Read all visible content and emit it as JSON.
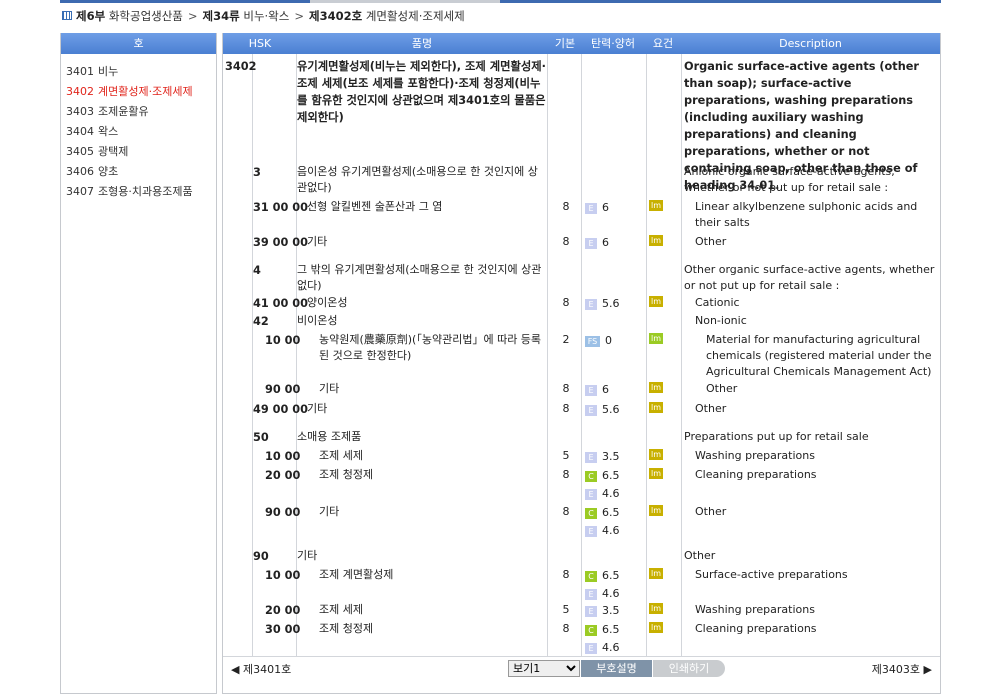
{
  "breadcrumb": {
    "part": "제6부",
    "part_label": "화학공업생산품",
    "chapter": "제34류",
    "chapter_label": "비누·왁스",
    "heading": "제3402호",
    "heading_label": "계면활성제·조제세제"
  },
  "sidebar": {
    "header": "호",
    "items": [
      {
        "code": "3401",
        "label": "비누"
      },
      {
        "code": "3402",
        "label": "계면활성제·조제세제",
        "active": true
      },
      {
        "code": "3403",
        "label": "조제윤활유"
      },
      {
        "code": "3404",
        "label": "왁스"
      },
      {
        "code": "3405",
        "label": "광택제"
      },
      {
        "code": "3406",
        "label": "양초"
      },
      {
        "code": "3407",
        "label": "조형용·치과용조제품"
      }
    ]
  },
  "table": {
    "headers": {
      "hsk": "HSK",
      "name": "품명",
      "base": "기본",
      "rate": "탄력·양허",
      "cond": "요건",
      "desc": "Description"
    }
  },
  "rows": [
    {
      "c1": "3402",
      "c2": "",
      "kr": "유기계면활성제(비누는 제외한다), 조제 계면활성제·조제 세제(보조 세제를 포함한다)·조제 청정제(비누를 함유한 것인지에 상관없으며 제3401호의 물품은 제외한다)",
      "en": "Organic surface-active agents (other than soap); surface-active preparations, washing preparations (including auxiliary washing preparations) and cleaning preparations, whether or not containing soap, other than those of heading 34.01.",
      "bold": true
    },
    {
      "c1": "",
      "c2": "3",
      "kr": "음이온성 유기계면활성제(소매용으로 한 것인지에 상관없다)",
      "en": "Anionic organic surface-active agents, whether or not put up for retail sale :"
    },
    {
      "c2": "31 00 00",
      "kr": "선형 알킬벤젠 술폰산과 그 염",
      "base": "8",
      "rates": [
        {
          "t": "E",
          "v": "6"
        }
      ],
      "lm": "lm",
      "en": "Linear alkylbenzene sulphonic acids and their salts"
    },
    {
      "c2": "39 00 00",
      "kr": "기타",
      "base": "8",
      "rates": [
        {
          "t": "E",
          "v": "6"
        }
      ],
      "lm": "lm",
      "en": "Other"
    },
    {
      "c2": "4",
      "kr": "그 밖의 유기계면활성제(소매용으로 한 것인지에 상관없다)",
      "en": "Other organic surface-active agents, whether or not put up for retail sale :"
    },
    {
      "c2": "41 00 00",
      "kr": "양이온성",
      "base": "8",
      "rates": [
        {
          "t": "E",
          "v": "5.6"
        }
      ],
      "lm": "lm",
      "en": "Cationic"
    },
    {
      "c2": "42",
      "kr": "비이온성",
      "en": "Non-ionic"
    },
    {
      "c2": "10 00",
      "kr": "농약원제(農藥原劑)(「농약관리법」에 따라 등록된 것으로 한정한다)",
      "base": "2",
      "rates": [
        {
          "t": "FS",
          "v": "0"
        }
      ],
      "lm": "lm",
      "lmg": true,
      "en": "Material for manufacturing agricultural chemicals (registered material under the Agricultural Chemicals Management Act)"
    },
    {
      "c2": "90 00",
      "kr": "기타",
      "base": "8",
      "rates": [
        {
          "t": "E",
          "v": "6"
        }
      ],
      "lm": "lm",
      "en": "Other"
    },
    {
      "c2": "49 00 00",
      "kr": "기타",
      "base": "8",
      "rates": [
        {
          "t": "E",
          "v": "5.6"
        }
      ],
      "lm": "lm",
      "en": "Other"
    },
    {
      "c2": "50",
      "kr": "소매용 조제품",
      "en": "Preparations put up for retail sale"
    },
    {
      "c2": "10 00",
      "kr": "조제 세제",
      "base": "5",
      "rates": [
        {
          "t": "E",
          "v": "3.5"
        }
      ],
      "lm": "lm",
      "en": "Washing preparations"
    },
    {
      "c2": "20 00",
      "kr": "조제 청정제",
      "base": "8",
      "rates": [
        {
          "t": "C",
          "v": "6.5"
        },
        {
          "t": "E",
          "v": "4.6"
        }
      ],
      "lm": "lm",
      "en": "Cleaning preparations"
    },
    {
      "c2": "90 00",
      "kr": "기타",
      "base": "8",
      "rates": [
        {
          "t": "C",
          "v": "6.5"
        },
        {
          "t": "E",
          "v": "4.6"
        }
      ],
      "lm": "lm",
      "en": "Other"
    },
    {
      "c2": "90",
      "kr": "기타",
      "en": "Other"
    },
    {
      "c2": "10 00",
      "kr": "조제 계면활성제",
      "base": "8",
      "rates": [
        {
          "t": "C",
          "v": "6.5"
        },
        {
          "t": "E",
          "v": "4.6"
        }
      ],
      "lm": "lm",
      "en": "Surface-active preparations"
    },
    {
      "c2": "20 00",
      "kr": "조제 세제",
      "base": "5",
      "rates": [
        {
          "t": "E",
          "v": "3.5"
        }
      ],
      "lm": "lm",
      "en": "Washing preparations"
    },
    {
      "c2": "30 00",
      "kr": "조제 청정제",
      "base": "8",
      "rates": [
        {
          "t": "C",
          "v": "6.5"
        },
        {
          "t": "E",
          "v": "4.6"
        }
      ],
      "lm": "lm",
      "en": "Cleaning preparations"
    }
  ],
  "footer": {
    "prev": "◀ 제3401호",
    "next": "제3403호 ▶",
    "view_select": "보기1",
    "btn_explain": "부호설명",
    "btn_print": "인쇄하기"
  },
  "colors": {
    "header_blue": "#4a7fd2",
    "active_red": "#e0241b",
    "tag_E": "#c7cef0",
    "tag_C": "#9bcb24",
    "tag_lm": "#c8b000"
  }
}
